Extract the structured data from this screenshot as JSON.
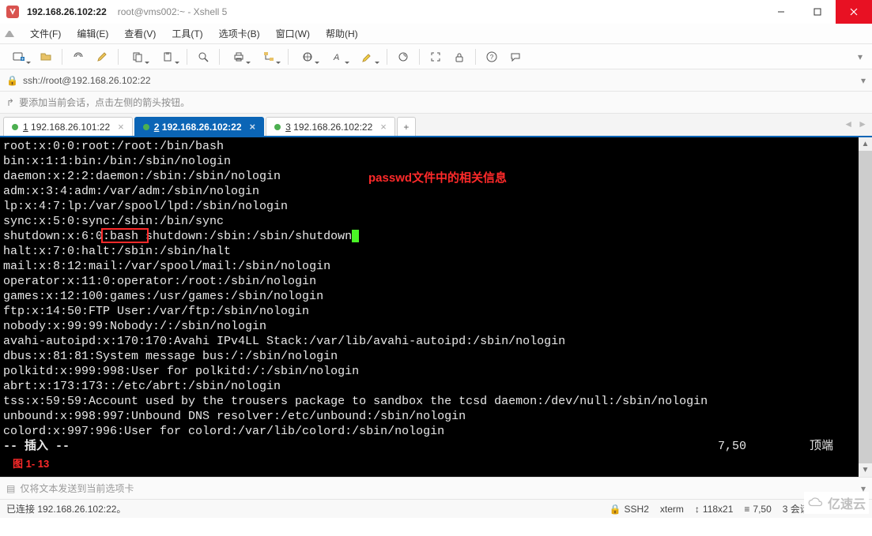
{
  "window": {
    "title_ip": "192.168.26.102:22",
    "title_sub": "root@vms002:~ - Xshell 5"
  },
  "menu": {
    "file": "文件(F)",
    "edit": "编辑(E)",
    "view": "查看(V)",
    "tools": "工具(T)",
    "tabs": "选项卡(B)",
    "window": "窗口(W)",
    "help": "帮助(H)"
  },
  "toolbar_icons": [
    "new-session-icon",
    "open-icon",
    "link-icon",
    "edit-icon",
    "copy-icon",
    "paste-icon",
    "search-icon",
    "print-icon",
    "folder-tree-icon",
    "globe-icon",
    "font-icon",
    "highlight-icon",
    "refresh-icon",
    "fullscreen-icon",
    "lock-icon",
    "help-icon",
    "chat-icon"
  ],
  "address": {
    "url": "ssh://root@192.168.26.102:22"
  },
  "hint": {
    "text": "要添加当前会话，点击左侧的箭头按钮。"
  },
  "tabs": [
    {
      "index": "1",
      "label": "192.168.26.101:22",
      "active": false
    },
    {
      "index": "2",
      "label": "192.168.26.102:22",
      "active": true
    },
    {
      "index": "3",
      "label": "192.168.26.102:22",
      "active": false
    }
  ],
  "terminal": {
    "annotation": "passwd文件中的相关信息",
    "mini_annotation": "图 1- 13",
    "lines_pre": "root:x:0:0:root:/root:/bin/bash\nbin:x:1:1:bin:/bin:/sbin/nologin\ndaemon:x:2:2:daemon:/sbin:/sbin/nologin\nadm:x:3:4:adm:/var/adm:/sbin/nologin\nlp:x:4:7:lp:/var/spool/lpd:/sbin/nologin\nsync:x:5:0:sync:/sbin:/bin/sync",
    "highlight_line_pre": "shutdown:x:6:0",
    "highlight_word": ":bash ",
    "highlight_line_post": "shutdown:/sbin:/sbin/shutdown",
    "lines_post": "halt:x:7:0:halt:/sbin:/sbin/halt\nmail:x:8:12:mail:/var/spool/mail:/sbin/nologin\noperator:x:11:0:operator:/root:/sbin/nologin\ngames:x:12:100:games:/usr/games:/sbin/nologin\nftp:x:14:50:FTP User:/var/ftp:/sbin/nologin\nnobody:x:99:99:Nobody:/:/sbin/nologin\navahi-autoipd:x:170:170:Avahi IPv4LL Stack:/var/lib/avahi-autoipd:/sbin/nologin\ndbus:x:81:81:System message bus:/:/sbin/nologin\npolkitd:x:999:998:User for polkitd:/:/sbin/nologin\nabrt:x:173:173::/etc/abrt:/sbin/nologin\ntss:x:59:59:Account used by the trousers package to sandbox the tcsd daemon:/dev/null:/sbin/nologin\nunbound:x:998:997:Unbound DNS resolver:/etc/unbound:/sbin/nologin\ncolord:x:997:996:User for colord:/var/lib/colord:/sbin/nologin",
    "mode": "-- 插入 --",
    "position": "7,50",
    "scroll_label": "顶端"
  },
  "inputbar": {
    "placeholder": "仅将文本发送到当前选项卡"
  },
  "status": {
    "connected": "已连接 192.168.26.102:22。",
    "protocol": "SSH2",
    "term_type": "xterm",
    "size": "118x21",
    "cursor": "7,50",
    "sessions": "3 会话"
  },
  "watermark": "亿速云"
}
